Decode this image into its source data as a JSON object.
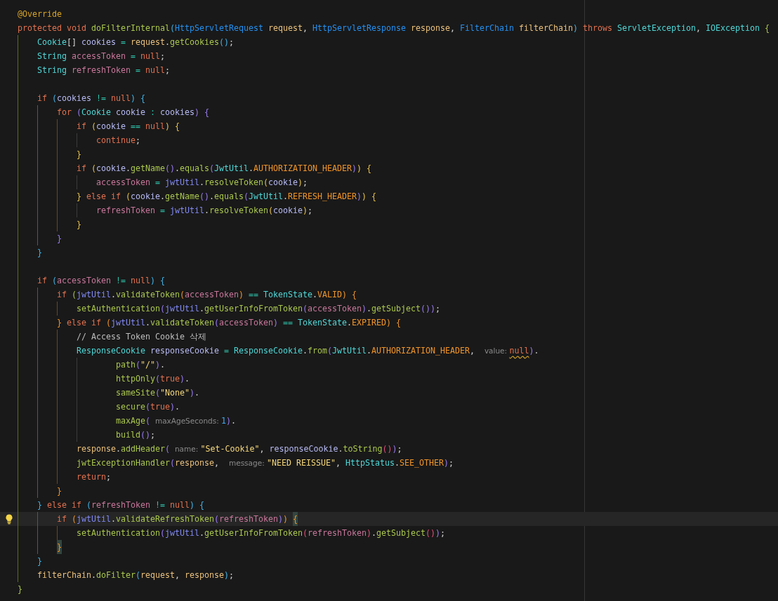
{
  "lines": [
    {
      "current": false,
      "tokens": [
        {
          "text": "@Override",
          "kind": "ann"
        }
      ]
    },
    {
      "current": false,
      "tokens": [
        {
          "text": "protected void ",
          "kind": "kw"
        },
        {
          "text": "doFilterInternal",
          "kind": "fn"
        },
        {
          "text": "(",
          "kind": "b3"
        },
        {
          "text": "HttpServletRequest ",
          "kind": "ptype"
        },
        {
          "text": "request",
          "kind": "param"
        },
        {
          "text": ", ",
          "kind": "punct"
        },
        {
          "text": "HttpServletResponse ",
          "kind": "ptype"
        },
        {
          "text": "response",
          "kind": "param"
        },
        {
          "text": ", ",
          "kind": "punct"
        },
        {
          "text": "FilterChain ",
          "kind": "ptype"
        },
        {
          "text": "filterChain",
          "kind": "param"
        },
        {
          "text": ") ",
          "kind": "b3"
        },
        {
          "text": "throws ",
          "kind": "kw"
        },
        {
          "text": "ServletException",
          "kind": "type"
        },
        {
          "text": ", ",
          "kind": "punct"
        },
        {
          "text": "IOException ",
          "kind": "type"
        },
        {
          "text": "{",
          "kind": "b4"
        }
      ],
      "children": [
        {
          "current": false,
          "tokens": [
            {
              "text": "Cookie",
              "kind": "type"
            },
            {
              "text": "[] ",
              "kind": "punct"
            },
            {
              "text": "cookies ",
              "kind": "local"
            },
            {
              "text": "= ",
              "kind": "op"
            },
            {
              "text": "request",
              "kind": "param"
            },
            {
              "text": ".",
              "kind": "punct"
            },
            {
              "text": "getCookies",
              "kind": "fn"
            },
            {
              "text": "()",
              "kind": "b3"
            },
            {
              "text": ";",
              "kind": "punct"
            }
          ]
        },
        {
          "current": false,
          "tokens": [
            {
              "text": "String ",
              "kind": "type"
            },
            {
              "text": "accessToken ",
              "kind": "field"
            },
            {
              "text": "= ",
              "kind": "op"
            },
            {
              "text": "null",
              "kind": "kw"
            },
            {
              "text": ";",
              "kind": "punct"
            }
          ]
        },
        {
          "current": false,
          "tokens": [
            {
              "text": "String ",
              "kind": "type"
            },
            {
              "text": "refreshToken ",
              "kind": "field"
            },
            {
              "text": "= ",
              "kind": "op"
            },
            {
              "text": "null",
              "kind": "kw"
            },
            {
              "text": ";",
              "kind": "punct"
            }
          ]
        },
        {
          "current": false
        },
        {
          "current": false,
          "tokens": [
            {
              "text": "if ",
              "kind": "kw"
            },
            {
              "text": "(",
              "kind": "b3"
            },
            {
              "text": "cookies ",
              "kind": "local"
            },
            {
              "text": "!= ",
              "kind": "op"
            },
            {
              "text": "null",
              "kind": "kw"
            },
            {
              "text": ") ",
              "kind": "b3"
            },
            {
              "text": "{",
              "kind": "b3"
            }
          ],
          "children": [
            {
              "current": false,
              "tokens": [
                {
                  "text": "for ",
                  "kind": "kw"
                },
                {
                  "text": "(",
                  "kind": "b2"
                },
                {
                  "text": "Cookie ",
                  "kind": "type"
                },
                {
                  "text": "cookie ",
                  "kind": "local"
                },
                {
                  "text": ": ",
                  "kind": "op"
                },
                {
                  "text": "cookies",
                  "kind": "local"
                },
                {
                  "text": ") ",
                  "kind": "b2"
                },
                {
                  "text": "{",
                  "kind": "b2"
                }
              ],
              "children": [
                {
                  "current": false,
                  "tokens": [
                    {
                      "text": "if ",
                      "kind": "kw"
                    },
                    {
                      "text": "(",
                      "kind": "b1"
                    },
                    {
                      "text": "cookie ",
                      "kind": "local"
                    },
                    {
                      "text": "== ",
                      "kind": "op"
                    },
                    {
                      "text": "null",
                      "kind": "kw"
                    },
                    {
                      "text": ") ",
                      "kind": "b1"
                    },
                    {
                      "text": "{",
                      "kind": "b1"
                    }
                  ],
                  "children": [
                    {
                      "current": false,
                      "tokens": [
                        {
                          "text": "continue",
                          "kind": "kw"
                        },
                        {
                          "text": ";",
                          "kind": "punct"
                        }
                      ]
                    }
                  ]
                },
                {
                  "current": false,
                  "tokens": [
                    {
                      "text": "}",
                      "kind": "b1"
                    }
                  ]
                },
                {
                  "current": false,
                  "tokens": [
                    {
                      "text": "if ",
                      "kind": "kw"
                    },
                    {
                      "text": "(",
                      "kind": "b1"
                    },
                    {
                      "text": "cookie",
                      "kind": "local"
                    },
                    {
                      "text": ".",
                      "kind": "punct"
                    },
                    {
                      "text": "getName",
                      "kind": "fn"
                    },
                    {
                      "text": "()",
                      "kind": "b2"
                    },
                    {
                      "text": ".",
                      "kind": "punct"
                    },
                    {
                      "text": "equals",
                      "kind": "fn"
                    },
                    {
                      "text": "(",
                      "kind": "b2"
                    },
                    {
                      "text": "JwtUtil",
                      "kind": "type"
                    },
                    {
                      "text": ".",
                      "kind": "punct"
                    },
                    {
                      "text": "AUTHORIZATION_HEADER",
                      "kind": "const"
                    },
                    {
                      "text": ")",
                      "kind": "b2"
                    },
                    {
                      "text": ") ",
                      "kind": "b1"
                    },
                    {
                      "text": "{",
                      "kind": "b1"
                    }
                  ],
                  "children": [
                    {
                      "current": false,
                      "tokens": [
                        {
                          "text": "accessToken ",
                          "kind": "field"
                        },
                        {
                          "text": "= ",
                          "kind": "op"
                        },
                        {
                          "text": "jwtUtil",
                          "kind": "obj"
                        },
                        {
                          "text": ".",
                          "kind": "punct"
                        },
                        {
                          "text": "resolveToken",
                          "kind": "fn"
                        },
                        {
                          "text": "(",
                          "kind": "b1"
                        },
                        {
                          "text": "cookie",
                          "kind": "local"
                        },
                        {
                          "text": ")",
                          "kind": "b1"
                        },
                        {
                          "text": ";",
                          "kind": "punct"
                        }
                      ]
                    }
                  ]
                },
                {
                  "current": false,
                  "tokens": [
                    {
                      "text": "} ",
                      "kind": "b1"
                    },
                    {
                      "text": "else if ",
                      "kind": "kw"
                    },
                    {
                      "text": "(",
                      "kind": "b1"
                    },
                    {
                      "text": "cookie",
                      "kind": "local"
                    },
                    {
                      "text": ".",
                      "kind": "punct"
                    },
                    {
                      "text": "getName",
                      "kind": "fn"
                    },
                    {
                      "text": "()",
                      "kind": "b2"
                    },
                    {
                      "text": ".",
                      "kind": "punct"
                    },
                    {
                      "text": "equals",
                      "kind": "fn"
                    },
                    {
                      "text": "(",
                      "kind": "b2"
                    },
                    {
                      "text": "JwtUtil",
                      "kind": "type"
                    },
                    {
                      "text": ".",
                      "kind": "punct"
                    },
                    {
                      "text": "REFRESH_HEADER",
                      "kind": "const"
                    },
                    {
                      "text": ")",
                      "kind": "b2"
                    },
                    {
                      "text": ") ",
                      "kind": "b1"
                    },
                    {
                      "text": "{",
                      "kind": "b1"
                    }
                  ],
                  "children": [
                    {
                      "current": false,
                      "tokens": [
                        {
                          "text": "refreshToken ",
                          "kind": "field"
                        },
                        {
                          "text": "= ",
                          "kind": "op"
                        },
                        {
                          "text": "jwtUtil",
                          "kind": "obj"
                        },
                        {
                          "text": ".",
                          "kind": "punct"
                        },
                        {
                          "text": "resolveToken",
                          "kind": "fn"
                        },
                        {
                          "text": "(",
                          "kind": "b1"
                        },
                        {
                          "text": "cookie",
                          "kind": "local"
                        },
                        {
                          "text": ")",
                          "kind": "b1"
                        },
                        {
                          "text": ";",
                          "kind": "punct"
                        }
                      ]
                    }
                  ]
                },
                {
                  "current": false,
                  "tokens": [
                    {
                      "text": "}",
                      "kind": "b1"
                    }
                  ]
                }
              ]
            },
            {
              "current": false,
              "tokens": [
                {
                  "text": "}",
                  "kind": "b2"
                }
              ]
            }
          ]
        },
        {
          "current": false,
          "tokens": [
            {
              "text": "}",
              "kind": "b3"
            }
          ]
        },
        {
          "current": false
        },
        {
          "current": false,
          "tokens": [
            {
              "text": "if ",
              "kind": "kw"
            },
            {
              "text": "(",
              "kind": "b3"
            },
            {
              "text": "accessToken ",
              "kind": "field"
            },
            {
              "text": "!= ",
              "kind": "op"
            },
            {
              "text": "null",
              "kind": "kw"
            },
            {
              "text": ") ",
              "kind": "b3"
            },
            {
              "text": "{",
              "kind": "b3"
            }
          ],
          "children": [
            {
              "current": false,
              "tokens": [
                {
                  "text": "if ",
                  "kind": "kw"
                },
                {
                  "text": "(",
                  "kind": "b4"
                },
                {
                  "text": "jwtUtil",
                  "kind": "obj"
                },
                {
                  "text": ".",
                  "kind": "punct"
                },
                {
                  "text": "validateToken",
                  "kind": "fn"
                },
                {
                  "text": "(",
                  "kind": "b5"
                },
                {
                  "text": "accessToken",
                  "kind": "field"
                },
                {
                  "text": ") ",
                  "kind": "b5"
                },
                {
                  "text": "== ",
                  "kind": "op"
                },
                {
                  "text": "TokenState",
                  "kind": "type"
                },
                {
                  "text": ".",
                  "kind": "punct"
                },
                {
                  "text": "VALID",
                  "kind": "const"
                },
                {
                  "text": ") ",
                  "kind": "b5"
                },
                {
                  "text": "{",
                  "kind": "b5"
                }
              ],
              "children": [
                {
                  "current": false,
                  "tokens": [
                    {
                      "text": "setAuthentication",
                      "kind": "fn"
                    },
                    {
                      "text": "(",
                      "kind": "b2"
                    },
                    {
                      "text": "jwtUtil",
                      "kind": "obj"
                    },
                    {
                      "text": ".",
                      "kind": "punct"
                    },
                    {
                      "text": "getUserInfoFromToken",
                      "kind": "fn"
                    },
                    {
                      "text": "(",
                      "kind": "b2"
                    },
                    {
                      "text": "accessToken",
                      "kind": "field"
                    },
                    {
                      "text": ")",
                      "kind": "b2"
                    },
                    {
                      "text": ".",
                      "kind": "punct"
                    },
                    {
                      "text": "getSubject",
                      "kind": "fn"
                    },
                    {
                      "text": "()",
                      "kind": "b2"
                    },
                    {
                      "text": ")",
                      "kind": "b2"
                    },
                    {
                      "text": ";",
                      "kind": "punct"
                    }
                  ]
                }
              ]
            },
            {
              "current": false,
              "tokens": [
                {
                  "text": "} ",
                  "kind": "b5"
                },
                {
                  "text": "else if ",
                  "kind": "kw"
                },
                {
                  "text": "(",
                  "kind": "b5"
                },
                {
                  "text": "jwtUtil",
                  "kind": "obj"
                },
                {
                  "text": ".",
                  "kind": "punct"
                },
                {
                  "text": "validateToken",
                  "kind": "fn"
                },
                {
                  "text": "(",
                  "kind": "b2"
                },
                {
                  "text": "accessToken",
                  "kind": "field"
                },
                {
                  "text": ") ",
                  "kind": "b2"
                },
                {
                  "text": "== ",
                  "kind": "op"
                },
                {
                  "text": "TokenState",
                  "kind": "type"
                },
                {
                  "text": ".",
                  "kind": "punct"
                },
                {
                  "text": "EXPIRED",
                  "kind": "const"
                },
                {
                  "text": ") ",
                  "kind": "b5"
                },
                {
                  "text": "{",
                  "kind": "b5"
                }
              ],
              "children": [
                {
                  "current": false,
                  "tokens": [
                    {
                      "text": "// Access Token Cookie 삭제",
                      "kind": "comment"
                    }
                  ]
                },
                {
                  "current": false,
                  "tokens": [
                    {
                      "text": "ResponseCookie ",
                      "kind": "type"
                    },
                    {
                      "text": "responseCookie ",
                      "kind": "local"
                    },
                    {
                      "text": "= ",
                      "kind": "op"
                    },
                    {
                      "text": "ResponseCookie",
                      "kind": "type"
                    },
                    {
                      "text": ".",
                      "kind": "punct"
                    },
                    {
                      "text": "from",
                      "kind": "fn"
                    },
                    {
                      "text": "(",
                      "kind": "b2"
                    },
                    {
                      "text": "JwtUtil",
                      "kind": "type"
                    },
                    {
                      "text": ".",
                      "kind": "punct"
                    },
                    {
                      "text": "AUTHORIZATION_HEADER",
                      "kind": "const"
                    },
                    {
                      "text": ",  ",
                      "kind": "punct"
                    },
                    {
                      "text": "value: ",
                      "kind": "hint"
                    },
                    {
                      "text": "null",
                      "kind": "warn"
                    },
                    {
                      "text": ")",
                      "kind": "b2"
                    },
                    {
                      "text": ".",
                      "kind": "punct"
                    }
                  ],
                  "children": [
                    {
                      "current": false,
                      "tokens": [
                        {
                          "text": "    path",
                          "kind": "fn"
                        },
                        {
                          "text": "(",
                          "kind": "b2"
                        },
                        {
                          "text": "\"/\"",
                          "kind": "str"
                        },
                        {
                          "text": ")",
                          "kind": "b2"
                        },
                        {
                          "text": ".",
                          "kind": "punct"
                        }
                      ]
                    },
                    {
                      "current": false,
                      "tokens": [
                        {
                          "text": "    httpOnly",
                          "kind": "fn"
                        },
                        {
                          "text": "(",
                          "kind": "b2"
                        },
                        {
                          "text": "true",
                          "kind": "kw"
                        },
                        {
                          "text": ")",
                          "kind": "b2"
                        },
                        {
                          "text": ".",
                          "kind": "punct"
                        }
                      ]
                    },
                    {
                      "current": false,
                      "tokens": [
                        {
                          "text": "    sameSite",
                          "kind": "fn"
                        },
                        {
                          "text": "(",
                          "kind": "b2"
                        },
                        {
                          "text": "\"None\"",
                          "kind": "str"
                        },
                        {
                          "text": ")",
                          "kind": "b2"
                        },
                        {
                          "text": ".",
                          "kind": "punct"
                        }
                      ]
                    },
                    {
                      "current": false,
                      "tokens": [
                        {
                          "text": "    secure",
                          "kind": "fn"
                        },
                        {
                          "text": "(",
                          "kind": "b2"
                        },
                        {
                          "text": "true",
                          "kind": "kw"
                        },
                        {
                          "text": ")",
                          "kind": "b2"
                        },
                        {
                          "text": ".",
                          "kind": "punct"
                        }
                      ]
                    },
                    {
                      "current": false,
                      "tokens": [
                        {
                          "text": "    maxAge",
                          "kind": "fn"
                        },
                        {
                          "text": "( ",
                          "kind": "b2"
                        },
                        {
                          "text": "maxAgeSeconds: ",
                          "kind": "hint"
                        },
                        {
                          "text": "1",
                          "kind": "num"
                        },
                        {
                          "text": ")",
                          "kind": "b2"
                        },
                        {
                          "text": ".",
                          "kind": "punct"
                        }
                      ]
                    },
                    {
                      "current": false,
                      "tokens": [
                        {
                          "text": "    build",
                          "kind": "fn"
                        },
                        {
                          "text": "()",
                          "kind": "b2"
                        },
                        {
                          "text": ";",
                          "kind": "punct"
                        }
                      ]
                    }
                  ]
                },
                {
                  "current": false,
                  "tokens": [
                    {
                      "text": "response",
                      "kind": "param"
                    },
                    {
                      "text": ".",
                      "kind": "punct"
                    },
                    {
                      "text": "addHeader",
                      "kind": "fn"
                    },
                    {
                      "text": "( ",
                      "kind": "b2"
                    },
                    {
                      "text": "name: ",
                      "kind": "hint"
                    },
                    {
                      "text": "\"Set-Cookie\"",
                      "kind": "str"
                    },
                    {
                      "text": ", ",
                      "kind": "punct"
                    },
                    {
                      "text": "responseCookie",
                      "kind": "local"
                    },
                    {
                      "text": ".",
                      "kind": "punct"
                    },
                    {
                      "text": "toString",
                      "kind": "fn"
                    },
                    {
                      "text": "()",
                      "kind": "b6"
                    },
                    {
                      "text": ")",
                      "kind": "b2"
                    },
                    {
                      "text": ";",
                      "kind": "punct"
                    }
                  ]
                },
                {
                  "current": false,
                  "tokens": [
                    {
                      "text": "jwtExceptionHandler",
                      "kind": "fn"
                    },
                    {
                      "text": "(",
                      "kind": "b2"
                    },
                    {
                      "text": "response",
                      "kind": "param"
                    },
                    {
                      "text": ",  ",
                      "kind": "punct"
                    },
                    {
                      "text": "message: ",
                      "kind": "hint"
                    },
                    {
                      "text": "\"NEED REISSUE\"",
                      "kind": "str"
                    },
                    {
                      "text": ", ",
                      "kind": "punct"
                    },
                    {
                      "text": "HttpStatus",
                      "kind": "type"
                    },
                    {
                      "text": ".",
                      "kind": "punct"
                    },
                    {
                      "text": "SEE_OTHER",
                      "kind": "const"
                    },
                    {
                      "text": ")",
                      "kind": "b2"
                    },
                    {
                      "text": ";",
                      "kind": "punct"
                    }
                  ]
                },
                {
                  "current": false,
                  "tokens": [
                    {
                      "text": "return",
                      "kind": "kw"
                    },
                    {
                      "text": ";",
                      "kind": "punct"
                    }
                  ]
                }
              ]
            },
            {
              "current": false,
              "tokens": [
                {
                  "text": "}",
                  "kind": "b5"
                }
              ]
            }
          ]
        },
        {
          "current": false,
          "tokens": [
            {
              "text": "} ",
              "kind": "b3"
            },
            {
              "text": "else if ",
              "kind": "kw"
            },
            {
              "text": "(",
              "kind": "b3"
            },
            {
              "text": "refreshToken ",
              "kind": "field"
            },
            {
              "text": "!= ",
              "kind": "op"
            },
            {
              "text": "null",
              "kind": "kw"
            },
            {
              "text": ") ",
              "kind": "b3"
            },
            {
              "text": "{",
              "kind": "b3"
            }
          ],
          "children": [
            {
              "current": true,
              "tokens": [
                {
                  "text": "if ",
                  "kind": "kw"
                },
                {
                  "text": "(",
                  "kind": "b5"
                },
                {
                  "text": "jwtUtil",
                  "kind": "obj"
                },
                {
                  "text": ".",
                  "kind": "punct"
                },
                {
                  "text": "validateRefreshToken",
                  "kind": "fn"
                },
                {
                  "text": "(",
                  "kind": "b2"
                },
                {
                  "text": "refreshToken",
                  "kind": "field"
                },
                {
                  "text": ")",
                  "kind": "b2"
                },
                {
                  "text": ") ",
                  "kind": "b5"
                },
                {
                  "text": "{",
                  "kind": "match"
                }
              ],
              "children": [
                {
                  "current": false,
                  "tokens": [
                    {
                      "text": "setAuthentication",
                      "kind": "fn"
                    },
                    {
                      "text": "(",
                      "kind": "b2"
                    },
                    {
                      "text": "jwtUtil",
                      "kind": "obj"
                    },
                    {
                      "text": ".",
                      "kind": "punct"
                    },
                    {
                      "text": "getUserInfoFromToken",
                      "kind": "fn"
                    },
                    {
                      "text": "(",
                      "kind": "b6"
                    },
                    {
                      "text": "refreshToken",
                      "kind": "field"
                    },
                    {
                      "text": ")",
                      "kind": "b6"
                    },
                    {
                      "text": ".",
                      "kind": "punct"
                    },
                    {
                      "text": "getSubject",
                      "kind": "fn"
                    },
                    {
                      "text": "()",
                      "kind": "b6"
                    },
                    {
                      "text": ")",
                      "kind": "b2"
                    },
                    {
                      "text": ";",
                      "kind": "punct"
                    }
                  ]
                }
              ]
            },
            {
              "current": false,
              "tokens": [
                {
                  "text": "}",
                  "kind": "match"
                }
              ]
            }
          ]
        },
        {
          "current": false,
          "tokens": [
            {
              "text": "}",
              "kind": "b3"
            }
          ]
        },
        {
          "current": false,
          "tokens": [
            {
              "text": "filterChain",
              "kind": "param"
            },
            {
              "text": ".",
              "kind": "punct"
            },
            {
              "text": "doFilter",
              "kind": "fn"
            },
            {
              "text": "(",
              "kind": "b3"
            },
            {
              "text": "request",
              "kind": "param"
            },
            {
              "text": ", ",
              "kind": "punct"
            },
            {
              "text": "response",
              "kind": "param"
            },
            {
              "text": ")",
              "kind": "b3"
            },
            {
              "text": ";",
              "kind": "punct"
            }
          ]
        }
      ]
    },
    {
      "current": false,
      "tokens": [
        {
          "text": "}",
          "kind": "b4"
        }
      ]
    }
  ]
}
